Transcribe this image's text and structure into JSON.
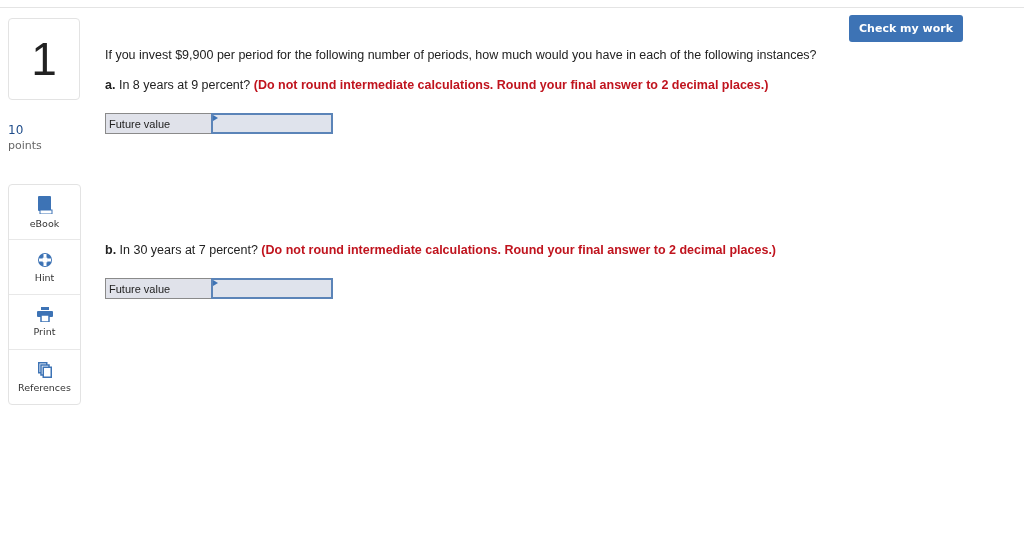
{
  "question_number": "1",
  "points": {
    "value": "10",
    "label": "points"
  },
  "tools": [
    {
      "kind": "ebook",
      "label": "eBook"
    },
    {
      "kind": "hint",
      "label": "Hint"
    },
    {
      "kind": "print",
      "label": "Print"
    },
    {
      "kind": "references",
      "label": "References"
    }
  ],
  "check_button": "Check my work",
  "intro": "If you invest $9,900 per period for the following number of periods, how much would you have in each of the following instances?",
  "parts": [
    {
      "question": "**a.** In 8 years at 9 percent?",
      "instruction": "(Do not round intermediate calculations. Round your final answer to 2 decimal places.)",
      "field_label": "Future value"
    },
    {
      "question": "**b.** In 30 years at 7 percent?",
      "instruction": "(Do not round intermediate calculations. Round your final answer to 2 decimal places.)",
      "field_label": "Future value"
    }
  ]
}
